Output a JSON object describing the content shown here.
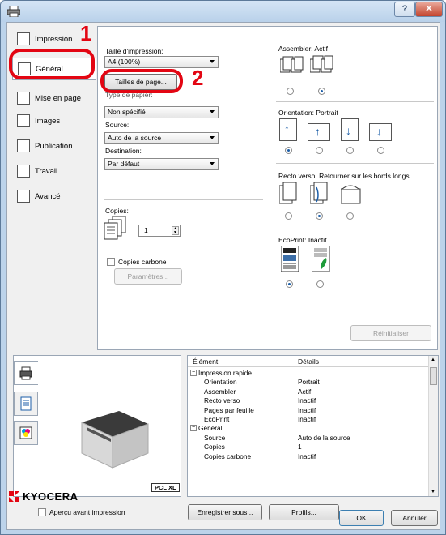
{
  "window": {
    "help_glyph": "?",
    "close_glyph": "✕"
  },
  "nav": {
    "items": [
      {
        "label": "Impression",
        "icon": "print-icon"
      },
      {
        "label": "Général",
        "icon": "general-icon"
      },
      {
        "label": "Mise en page",
        "icon": "layout-icon"
      },
      {
        "label": "Images",
        "icon": "images-icon"
      },
      {
        "label": "Publication",
        "icon": "publishing-icon"
      },
      {
        "label": "Travail",
        "icon": "job-icon"
      },
      {
        "label": "Avancé",
        "icon": "advanced-icon"
      }
    ],
    "active_index": 1
  },
  "general": {
    "print_size_label": "Taille d'impression:",
    "print_size_value": "A4 (100%)",
    "page_sizes_button": "Tailles de page...",
    "paper_type_label": "Type de papier:",
    "paper_type_value": "Non spécifié",
    "source_label": "Source:",
    "source_value": "Auto de la source",
    "destination_label": "Destination:",
    "destination_value": "Par défaut",
    "copies_label": "Copies:",
    "copies_value": "1",
    "carbon_copies_label": "Copies carbone",
    "settings_button": "Paramètres..."
  },
  "right": {
    "collate_label": "Assembler: Actif",
    "orientation_label": "Orientation: Portrait",
    "duplex_label": "Recto verso: Retourner sur les bords longs",
    "ecoprint_label": "EcoPrint: Inactif",
    "reset_button": "Réinitialiser"
  },
  "callouts": {
    "one": "1",
    "two": "2"
  },
  "preview": {
    "badge": "PCL XL",
    "preview_checkbox": "Aperçu avant impression"
  },
  "details": {
    "headers": [
      "Élément",
      "Détails"
    ],
    "rows": [
      {
        "group": true,
        "item": "Impression rapide",
        "value": ""
      },
      {
        "group": false,
        "item": "Orientation",
        "value": "Portrait"
      },
      {
        "group": false,
        "item": "Assembler",
        "value": "Actif"
      },
      {
        "group": false,
        "item": "Recto verso",
        "value": "Inactif"
      },
      {
        "group": false,
        "item": "Pages par feuille",
        "value": "Inactif"
      },
      {
        "group": false,
        "item": "EcoPrint",
        "value": "Inactif"
      },
      {
        "group": true,
        "item": "Général",
        "value": ""
      },
      {
        "group": false,
        "item": "Source",
        "value": "Auto de la source"
      },
      {
        "group": false,
        "item": "Copies",
        "value": "1"
      },
      {
        "group": false,
        "item": "Copies carbone",
        "value": "Inactif"
      }
    ],
    "expander_glyph": "−"
  },
  "buttons": {
    "save_as": "Enregistrer sous...",
    "profiles": "Profils...",
    "ok": "OK",
    "cancel": "Annuler"
  },
  "brand": {
    "name": "KYOCERA",
    "accent": "#e30613"
  }
}
